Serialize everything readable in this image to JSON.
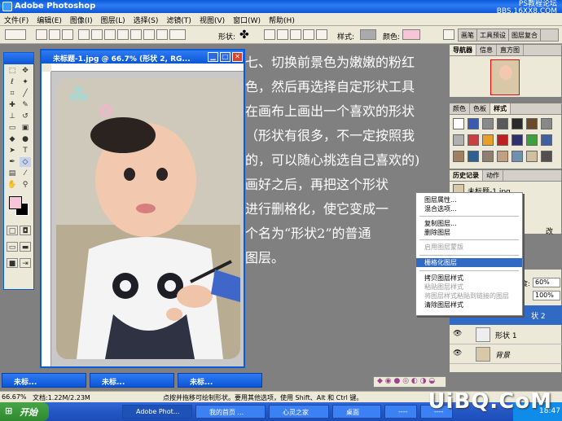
{
  "title_bar": {
    "title": "Adobe Photoshop",
    "watermark": "PS教程论坛\nBBS.16XX8.COM"
  },
  "menu": [
    "文件(F)",
    "编辑(E)",
    "图像(I)",
    "图层(L)",
    "选择(S)",
    "滤镜(T)",
    "视图(V)",
    "窗口(W)",
    "帮助(H)"
  ],
  "options_bar": {
    "shape_label": "形状:",
    "style_label": "样式:",
    "color_label": "颜色:",
    "color_value": "#f6c6d8"
  },
  "palette_well": [
    "画笔",
    "工具预设",
    "图层复合"
  ],
  "document": {
    "title": "未标题-1.jpg @ 66.7% (形状 2, RG..."
  },
  "overlay_lines": [
    "七、切换前景色为嫩嫩的粉红",
    "色，然后再选择自定形状工具",
    "在画布上画出一个喜欢的形状",
    "（形状有很多，不一定按照我",
    "的，可以随心挑选自己喜欢的)",
    "画好之后，再把这个形状",
    "进行删格化，使它变成一",
    "个名为“形状2”的普通",
    "图层。"
  ],
  "navigator_tabs": [
    "导航器",
    "信息",
    "直方图"
  ],
  "color_tabs": [
    "颜色",
    "色板",
    "样式"
  ],
  "history_tabs": [
    "历史记录",
    "动作"
  ],
  "history_item": "未标题-1.jpg",
  "context_menu": [
    {
      "label": "图层属性...",
      "state": "normal"
    },
    {
      "label": "混合选项...",
      "state": "normal"
    },
    {
      "label": "复制图层...",
      "state": "normal"
    },
    {
      "label": "删除图层",
      "state": "normal"
    },
    {
      "label": "启用图层蒙版",
      "state": "disabled"
    },
    {
      "label": "栅格化图层",
      "state": "selected"
    },
    {
      "label": "拷贝图层样式",
      "state": "normal"
    },
    {
      "label": "粘贴图层样式",
      "state": "disabled"
    },
    {
      "label": "将图层样式粘贴到链接的图层",
      "state": "disabled"
    },
    {
      "label": "清除图层样式",
      "state": "normal"
    }
  ],
  "layers_panel": {
    "opacity_label": "度:",
    "opacity": "60%",
    "fill": "100%",
    "layers": [
      "状 2",
      "形状 1",
      "背景"
    ],
    "side_text": "改"
  },
  "minimized_docs": [
    "未标...",
    "未标...",
    "未标..."
  ],
  "status_bar": {
    "zoom": "66.67%",
    "doc": "文档:1.22M/2.23M",
    "hint": "点按并拖移可绘制形状。要用其他选项，使用 Shift、Alt 和 Ctrl 键。"
  },
  "taskbar": {
    "start": "开始",
    "tasks": [
      "Adobe Phot...",
      "我的首页 ...",
      "心灵之家",
      "桌面",
      "----",
      "----"
    ],
    "clock": "18:47"
  },
  "watermark_bottom": "UiBQ.CoM",
  "colors": {
    "xp_blue": "#0b56d6",
    "menu_bg": "#ece9d8",
    "foreground": "#f6c6d8"
  }
}
